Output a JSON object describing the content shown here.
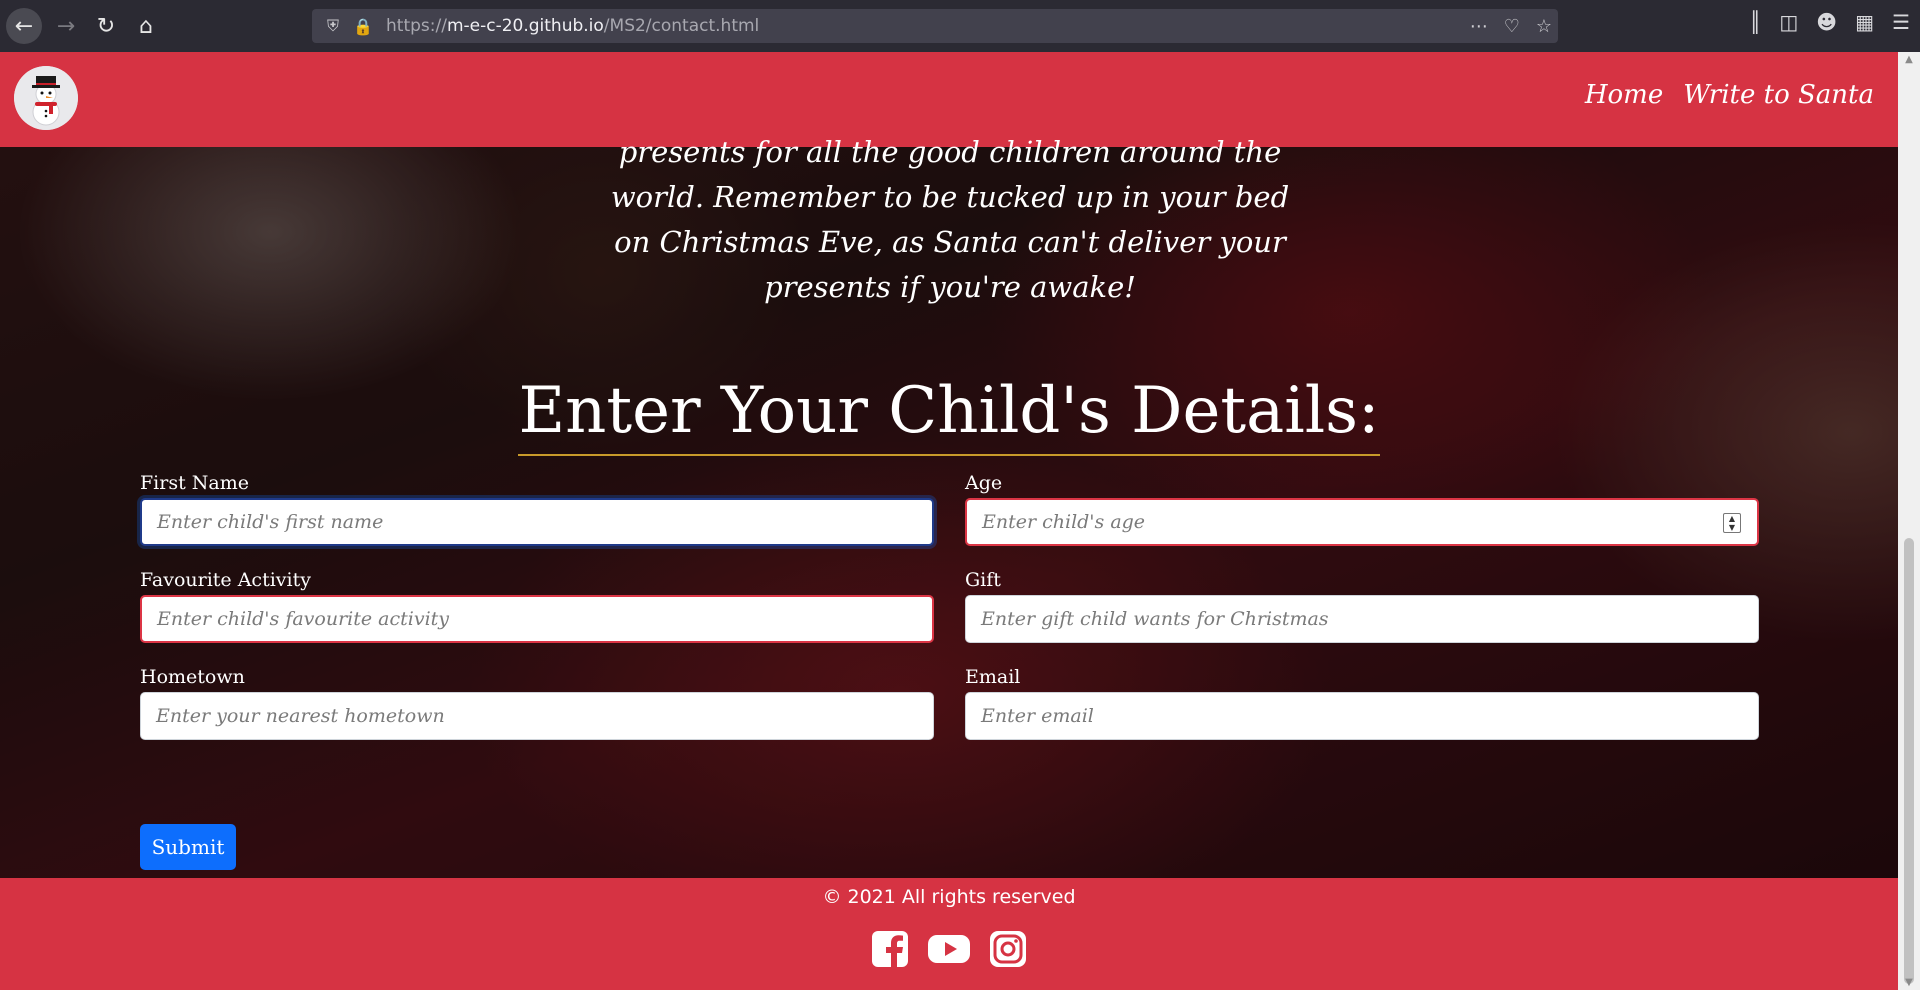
{
  "browser": {
    "url_prefix": "https://",
    "url_domain": "m-e-c-20.github.io",
    "url_path": "/MS2/contact.html"
  },
  "navbar": {
    "links": [
      {
        "label": "Home"
      },
      {
        "label": "Write to Santa"
      }
    ]
  },
  "intro": {
    "lines": [
      "presents for all the good children around the",
      "world. Remember to be tucked up in your bed",
      "on Christmas Eve, as Santa can't deliver your",
      "presents if you're awake!"
    ]
  },
  "form": {
    "title": "Enter Your Child's Details:",
    "fields": [
      {
        "label": "First Name",
        "placeholder": "Enter child's first name",
        "state": "focused"
      },
      {
        "label": "Age",
        "placeholder": "Enter child's age",
        "state": "invalid"
      },
      {
        "label": "Favourite Activity",
        "placeholder": "Enter child's favourite activity",
        "state": "invalid"
      },
      {
        "label": "Gift",
        "placeholder": "Enter gift child wants for Christmas",
        "state": "normal"
      },
      {
        "label": "Hometown",
        "placeholder": "Enter your nearest hometown",
        "state": "normal"
      },
      {
        "label": "Email",
        "placeholder": "Enter email",
        "state": "normal"
      }
    ],
    "submit_label": "Submit"
  },
  "footer": {
    "copyright": "© 2021 All rights reserved",
    "social_icons": [
      "facebook-icon",
      "youtube-icon",
      "instagram-icon"
    ]
  },
  "colors": {
    "brand_red": "#d63343",
    "button_blue": "#0d6efd",
    "invalid_red": "#dc3545",
    "title_underline": "#c89a2a"
  }
}
